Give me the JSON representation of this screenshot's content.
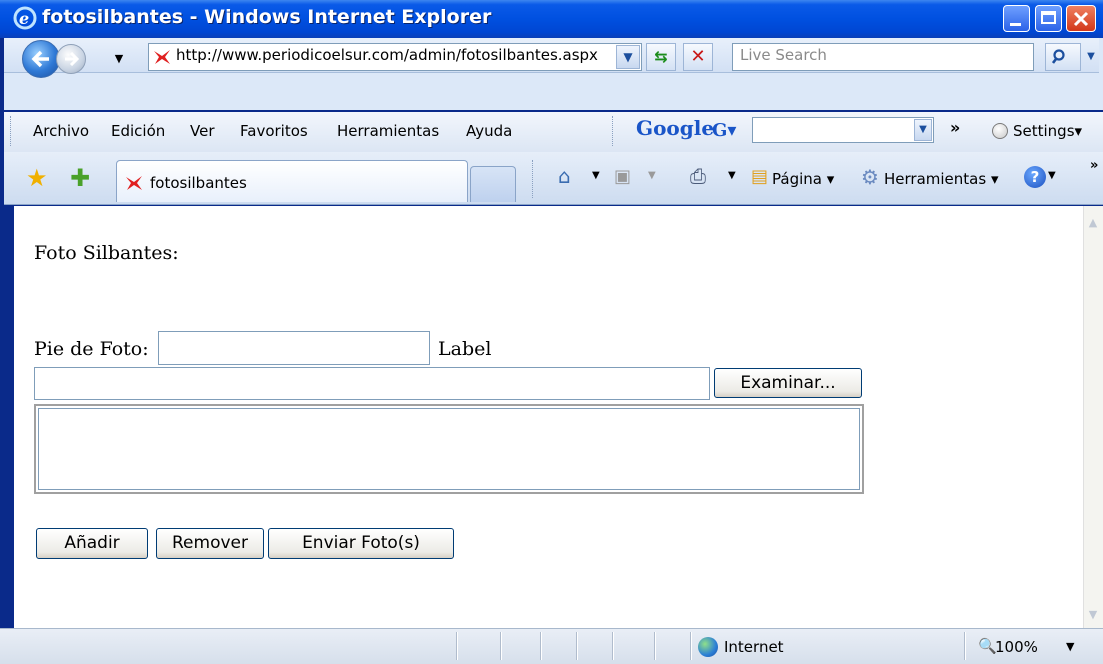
{
  "window": {
    "title": "fotosilbantes - Windows Internet Explorer"
  },
  "nav": {
    "url": "http://www.periodicoelsur.com/admin/fotosilbantes.aspx",
    "search_placeholder": "Live Search"
  },
  "menu": [
    "Archivo",
    "Edición",
    "Ver",
    "Favoritos",
    "Herramientas",
    "Ayuda"
  ],
  "google_toolbar": {
    "logo": "Google",
    "box_label": "G▾",
    "settings": "Settings▾"
  },
  "tabs": {
    "active_label": "fotosilbantes"
  },
  "command_bar": {
    "page": "Página ▾",
    "tools": "Herramientas ▾"
  },
  "page": {
    "heading": "Foto Silbantes:",
    "caption_label": "Pie de Foto:",
    "caption_value": "",
    "side_label": "Label",
    "browse_button": "Examinar...",
    "add_button": "Añadir",
    "remove_button": "Remover",
    "send_button": "Enviar Foto(s)"
  },
  "status": {
    "zone": "Internet",
    "zoom": "100%"
  }
}
